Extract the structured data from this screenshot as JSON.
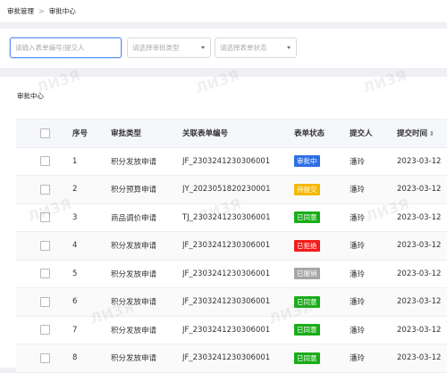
{
  "breadcrumb": {
    "root": "审批管理",
    "separator": ">",
    "current": "审批中心"
  },
  "filters": {
    "search_placeholder": "请输入表单编号/提交人",
    "type_placeholder": "请选择审批类型",
    "status_placeholder": "请选择表单状态"
  },
  "panel": {
    "title": "审批中心"
  },
  "columns": {
    "index": "序号",
    "type": "审批类型",
    "form_no": "关联表单编号",
    "status": "表单状态",
    "submitter": "提交人",
    "time": "提交时间",
    "time_sort": "⇕"
  },
  "status_colors": {
    "审批中": "#2f6fe4",
    "待提交": "#f5b800",
    "已同意": "#1aad19",
    "已拒绝": "#f21b1b",
    "已撤销": "#a6a6a6"
  },
  "rows": [
    {
      "index": "1",
      "type": "积分发放申请",
      "form_no": "JF_2303241230306001",
      "status": "审批中",
      "submitter": "潘玲",
      "time": "2023-03-12"
    },
    {
      "index": "2",
      "type": "积分预算申请",
      "form_no": "JY_2023051820230001",
      "status": "待提交",
      "submitter": "潘玲",
      "time": "2023-03-12"
    },
    {
      "index": "3",
      "type": "商品调价申请",
      "form_no": "TJ_2303241230306001",
      "status": "已同意",
      "submitter": "潘玲",
      "time": "2023-03-12"
    },
    {
      "index": "4",
      "type": "积分发放申请",
      "form_no": "JF_2303241230306001",
      "status": "已拒绝",
      "submitter": "潘玲",
      "time": "2023-03-12"
    },
    {
      "index": "5",
      "type": "积分发放申请",
      "form_no": "JF_2303241230306001",
      "status": "已撤销",
      "submitter": "潘玲",
      "time": "2023-03-12"
    },
    {
      "index": "6",
      "type": "积分发放申请",
      "form_no": "JF_2303241230306001",
      "status": "已同意",
      "submitter": "潘玲",
      "time": "2023-03-12"
    },
    {
      "index": "7",
      "type": "积分发放申请",
      "form_no": "JF_2303241230306001",
      "status": "已同意",
      "submitter": "潘玲",
      "time": "2023-03-12"
    },
    {
      "index": "8",
      "type": "积分发放申请",
      "form_no": "JF_2303241230306001",
      "status": "已同意",
      "submitter": "潘玲",
      "time": "2023-03-12"
    }
  ]
}
